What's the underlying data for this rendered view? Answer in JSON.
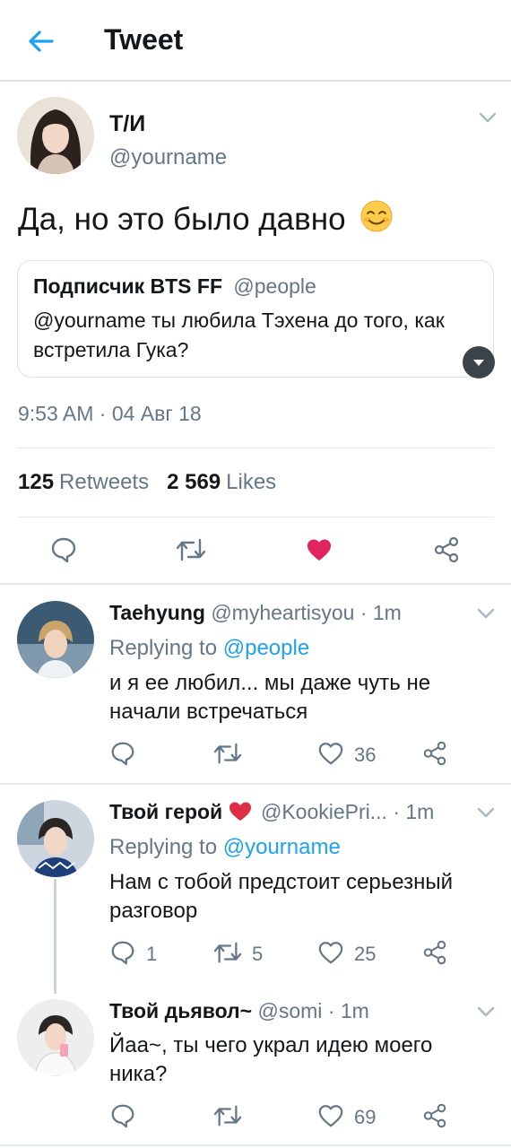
{
  "header": {
    "title": "Tweet"
  },
  "tweet": {
    "author_name": "Т/И",
    "author_handle": "@yourname",
    "text": "Да, но это было давно",
    "quote": {
      "author_name": "Подписчик BTS FF",
      "author_handle": "@people",
      "text": "@yourname ты любила Тэхена до того, как встретила Гука?"
    },
    "timestamp": "9:53 AM · 04 Авг 18",
    "retweets_count": "125",
    "retweets_label": "Retweets",
    "likes_count": "2 569",
    "likes_label": "Likes",
    "liked": true
  },
  "replies": [
    {
      "name": "Taehyung",
      "handle": "@myheartisyou",
      "time": "· 1m",
      "replying_prefix": "Replying to",
      "replying_to": "@people",
      "text": "и я ее любил... мы даже чуть не начали встречаться",
      "comments": "",
      "retweets": "",
      "likes": "36"
    },
    {
      "name": "Твой герой",
      "handle": "@KookiePri...",
      "time": "· 1m",
      "replying_prefix": "Replying to",
      "replying_to": "@yourname",
      "text": "Нам с тобой предстоит серьезный разговор",
      "comments": "1",
      "retweets": "5",
      "likes": "25"
    },
    {
      "name": "Твой дьявол~",
      "handle": "@somi",
      "time": "· 1m",
      "text": "Йаа~, ты чего украл идею моего ника?",
      "comments": "",
      "retweets": "",
      "likes": "69"
    }
  ],
  "colors": {
    "accent": "#1da1f2",
    "like": "#e0245e",
    "muted": "#657786"
  },
  "icons": [
    "back-arrow-icon",
    "chevron-down-icon",
    "reply-icon",
    "retweet-icon",
    "heart-icon",
    "share-icon",
    "smiling-face-emoji",
    "red-heart-emoji"
  ]
}
